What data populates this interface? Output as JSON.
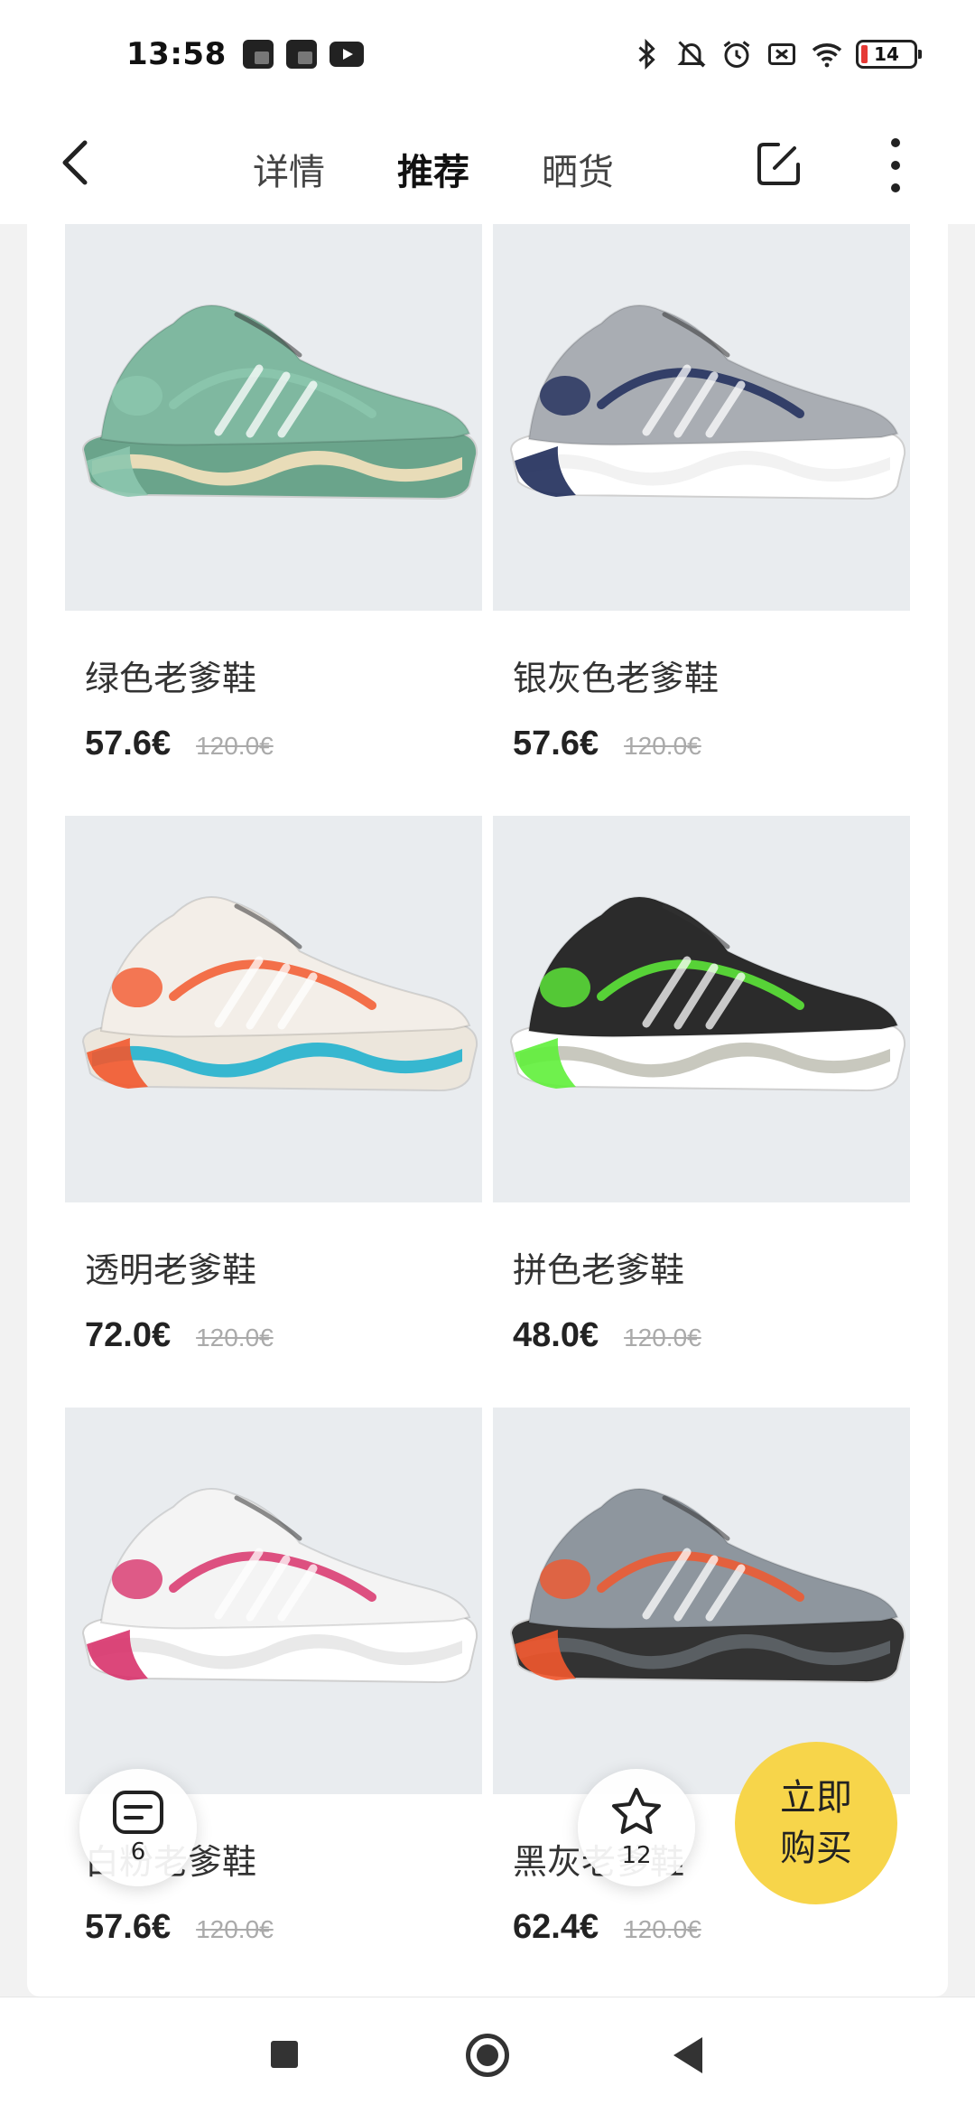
{
  "status_bar": {
    "time": "13:58",
    "battery": "14",
    "icons": [
      "notification-icon",
      "notification-icon",
      "youtube-icon",
      "bluetooth-icon",
      "mute-icon",
      "alarm-icon",
      "sim-off-icon",
      "wifi-icon",
      "battery-icon"
    ]
  },
  "header": {
    "tabs": [
      {
        "label": "详情"
      },
      {
        "label": "推荐"
      },
      {
        "label": "晒货"
      }
    ],
    "active_tab": "推荐"
  },
  "products": [
    {
      "name": "绿色老爹鞋",
      "price": "57.6€",
      "old_price": "120.0€",
      "colors": {
        "upper": "#7fb8a0",
        "sole": "#6aa48b",
        "mid": "#e8dcb8",
        "accent": "#8cc7ae"
      }
    },
    {
      "name": "银灰色老爹鞋",
      "price": "57.6€",
      "old_price": "120.0€",
      "colors": {
        "upper": "#a9adb3",
        "sole": "#ffffff",
        "mid": "#f2f2f2",
        "accent": "#1f2c5a"
      }
    },
    {
      "name": "透明老爹鞋",
      "price": "72.0€",
      "old_price": "120.0€",
      "colors": {
        "upper": "#f3eee8",
        "sole": "#ece6dc",
        "mid": "#36b7d0",
        "accent": "#f2582d"
      }
    },
    {
      "name": "拼色老爹鞋",
      "price": "48.0€",
      "old_price": "120.0€",
      "colors": {
        "upper": "#2b2b2b",
        "sole": "#ffffff",
        "mid": "#c8c8be",
        "accent": "#5ff03a"
      }
    },
    {
      "name": "白粉老爹鞋",
      "price": "57.6€",
      "old_price": "120.0€",
      "colors": {
        "upper": "#f4f4f4",
        "sole": "#ffffff",
        "mid": "#e9e9e9",
        "accent": "#d8336b"
      }
    },
    {
      "name": "黑灰老爹鞋",
      "price": "62.4€",
      "old_price": "120.0€",
      "colors": {
        "upper": "#8e969e",
        "sole": "#333333",
        "mid": "#5a5f63",
        "accent": "#f2582d"
      }
    }
  ],
  "floating": {
    "comments_count": "6",
    "favorites_count": "12",
    "buy_line1": "立即",
    "buy_line2": "购买"
  },
  "colors": {
    "accent_yellow": "#f7d54a",
    "image_bg": "#e9ecef"
  }
}
